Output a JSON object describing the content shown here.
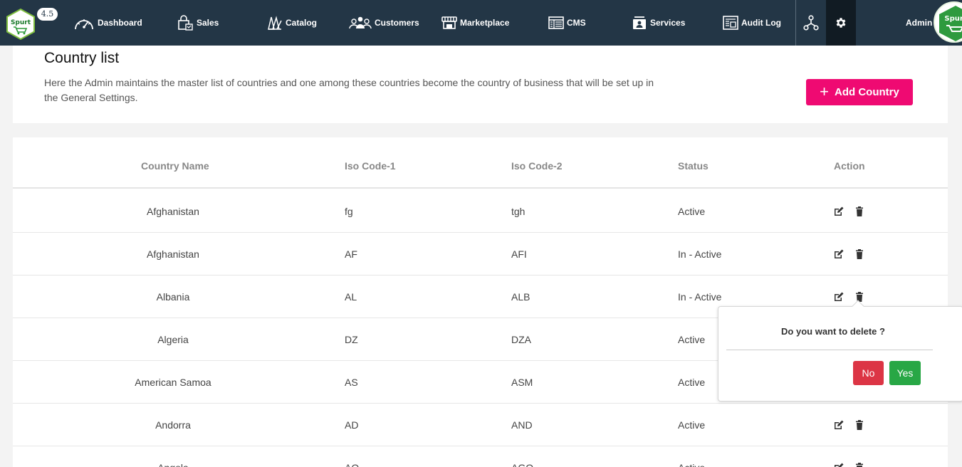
{
  "nav": {
    "version": "4.5",
    "items": [
      {
        "label": "Dashboard",
        "icon": "gauge-icon"
      },
      {
        "label": "Sales",
        "icon": "shopping-bag-icon"
      },
      {
        "label": "Catalog",
        "icon": "catalog-icon"
      },
      {
        "label": "Customers",
        "icon": "users-icon"
      },
      {
        "label": "Marketplace",
        "icon": "store-icon"
      },
      {
        "label": "CMS",
        "icon": "cms-icon"
      },
      {
        "label": "Services",
        "icon": "services-icon"
      },
      {
        "label": "Audit Log",
        "icon": "audit-log-icon"
      }
    ],
    "admin_label": "Admin",
    "logo_text": "Spurt",
    "avatar_text": "Spurt"
  },
  "header": {
    "title": "Country list",
    "description": "Here the Admin maintains the master list of countries and one among these countries become the country of business that will be set up in the General Settings.",
    "add_button": "Add Country"
  },
  "table": {
    "columns": [
      "Country Name",
      "Iso Code-1",
      "Iso Code-2",
      "Status",
      "Action"
    ],
    "rows": [
      {
        "name": "Afghanistan",
        "iso1": "fg",
        "iso2": "tgh",
        "status": "Active"
      },
      {
        "name": "Afghanistan",
        "iso1": "AF",
        "iso2": "AFI",
        "status": "In - Active"
      },
      {
        "name": "Albania",
        "iso1": "AL",
        "iso2": "ALB",
        "status": "In - Active"
      },
      {
        "name": "Algeria",
        "iso1": "DZ",
        "iso2": "DZA",
        "status": "Active"
      },
      {
        "name": "American Samoa",
        "iso1": "AS",
        "iso2": "ASM",
        "status": "Active"
      },
      {
        "name": "Andorra",
        "iso1": "AD",
        "iso2": "AND",
        "status": "Active"
      },
      {
        "name": "Angola",
        "iso1": "AO",
        "iso2": "AGO",
        "status": "Active"
      }
    ]
  },
  "popover": {
    "question": "Do you want to delete ?",
    "no_label": "No",
    "yes_label": "Yes"
  },
  "colors": {
    "nav_bg": "#233646",
    "accent": "#ef0a72",
    "danger": "#dc3545",
    "success": "#28a745"
  }
}
